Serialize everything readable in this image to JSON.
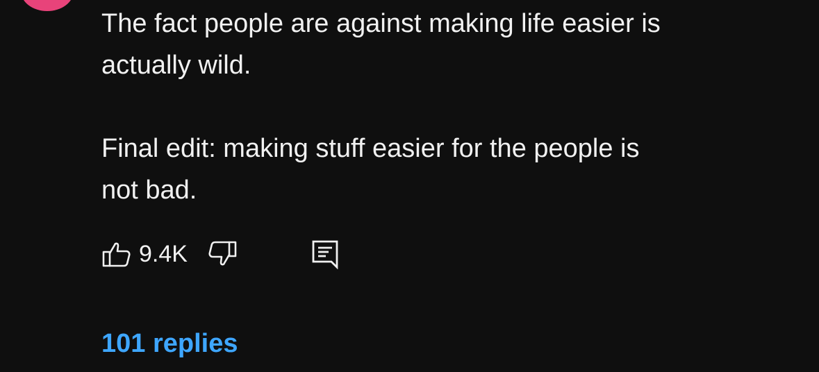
{
  "comment": {
    "paragraphs": [
      "The fact people are against making life easier is\nactually wild.",
      "Final edit: making stuff easier for the people is\nnot bad."
    ]
  },
  "actions": {
    "like_count": "9.4K",
    "like_icon": "thumbs-up-icon",
    "dislike_icon": "thumbs-down-icon",
    "reply_icon": "comment-icon"
  },
  "replies": {
    "label": "101 replies"
  },
  "colors": {
    "background": "#0f0f0f",
    "text": "#f1f1f1",
    "link": "#3ea6ff",
    "avatar": "#e8437a"
  }
}
